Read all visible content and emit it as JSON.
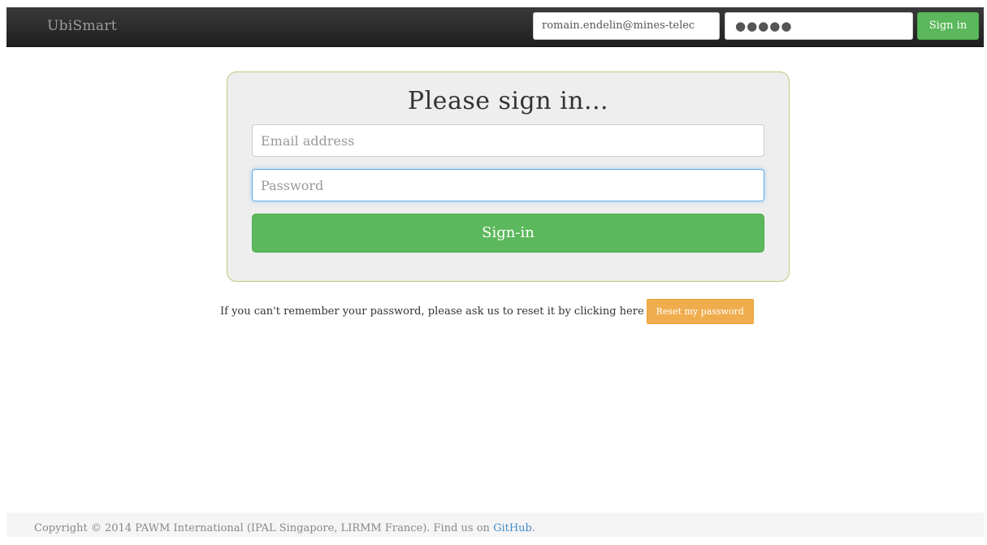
{
  "navbar": {
    "brand": "UbiSmart",
    "email_value": "romain.endelin@mines-telec",
    "password_value": "●●●●●",
    "signin_label": "Sign in"
  },
  "signin_form": {
    "heading": "Please sign in...",
    "email_placeholder": "Email address",
    "password_placeholder": "Password",
    "submit_label": "Sign-in"
  },
  "reset": {
    "text": "If you can't remember your password, please ask us to reset it by clicking here",
    "button_label": "Reset my password"
  },
  "footer": {
    "copyright": "Copyright © 2014 PAWM International (IPAL Singapore, LIRMM France). Find us on ",
    "link_label": "GitHub",
    "trailing": "."
  },
  "colors": {
    "navbar_bg": "#222222",
    "success": "#5cb85c",
    "warning": "#f0ad4e",
    "panel_bg": "#eeeeee",
    "panel_border": "#b5cf7a",
    "link": "#428bca"
  }
}
